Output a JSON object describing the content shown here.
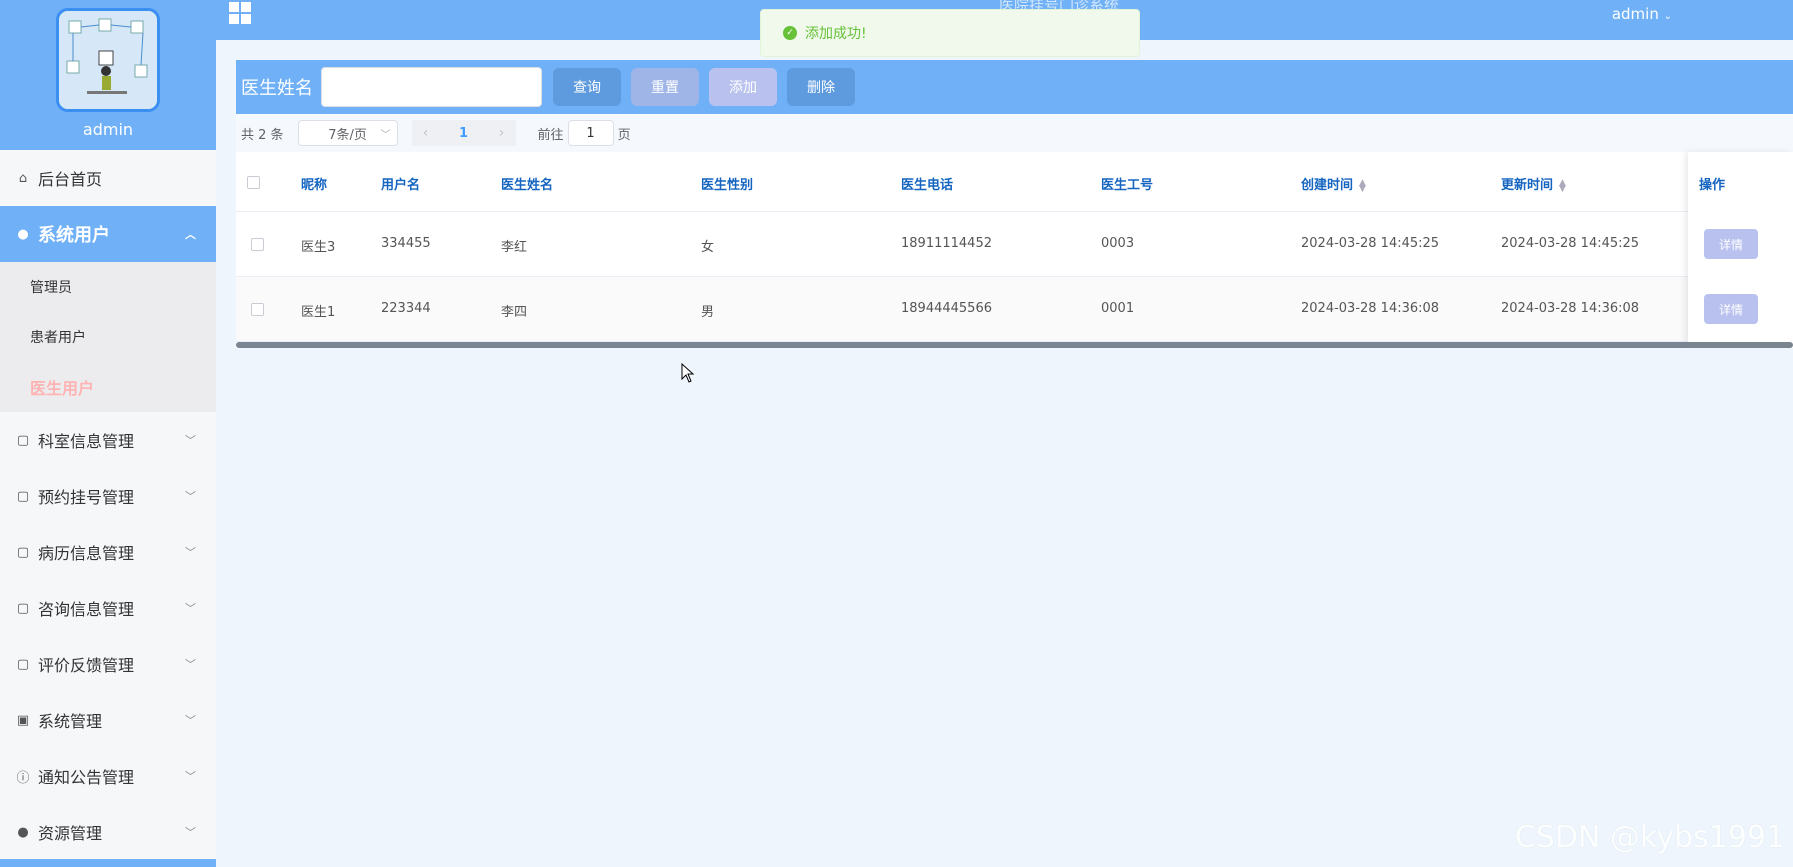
{
  "sidebar": {
    "profile_name": "admin",
    "items": [
      {
        "label": "后台首页",
        "icon": "home-icon"
      },
      {
        "label": "系统用户",
        "icon": "user-icon",
        "active": true,
        "children": [
          {
            "label": "管理员"
          },
          {
            "label": "患者用户"
          },
          {
            "label": "医生用户",
            "current": true
          }
        ]
      },
      {
        "label": "科室信息管理",
        "icon": "folder-icon"
      },
      {
        "label": "预约挂号管理",
        "icon": "folder-icon"
      },
      {
        "label": "病历信息管理",
        "icon": "folder-icon"
      },
      {
        "label": "咨询信息管理",
        "icon": "folder-icon"
      },
      {
        "label": "评价反馈管理",
        "icon": "folder-icon"
      },
      {
        "label": "系统管理",
        "icon": "picture-icon"
      },
      {
        "label": "通知公告管理",
        "icon": "info-icon"
      },
      {
        "label": "资源管理",
        "icon": "bulb-icon"
      }
    ]
  },
  "header": {
    "title": "医院挂号门诊系统",
    "user_menu": "admin"
  },
  "toast": {
    "message": "添加成功!",
    "color": "#67c23a"
  },
  "search": {
    "label": "医生姓名",
    "value": "",
    "buttons": {
      "query": "查询",
      "reset": "重置",
      "add": "添加",
      "delete": "删除"
    }
  },
  "pagination": {
    "total": "共 2 条",
    "page_size": "7条/页",
    "current_page": "1",
    "goto_prefix": "前往",
    "goto_value": "1",
    "goto_suffix": "页"
  },
  "table": {
    "columns": [
      "昵称",
      "用户名",
      "医生姓名",
      "医生性别",
      "医生电话",
      "医生工号",
      "创建时间",
      "更新时间",
      "操作"
    ],
    "rows": [
      {
        "nickname": "医生3",
        "username": "334455",
        "name": "李红",
        "gender": "女",
        "phone": "18911114452",
        "job_no": "0003",
        "created": "2024-03-28 14:45:25",
        "updated": "2024-03-28 14:45:25",
        "action": "详情"
      },
      {
        "nickname": "医生1",
        "username": "223344",
        "name": "李四",
        "gender": "男",
        "phone": "18944445566",
        "job_no": "0001",
        "created": "2024-03-28 14:36:08",
        "updated": "2024-03-28 14:36:08",
        "action": "详情"
      }
    ]
  },
  "watermark": "CSDN @kybs1991",
  "colors": {
    "primary": "#6fb0f7",
    "button_blue": "#5d9ade",
    "button_light": "#b9c2ee",
    "header_text": "#1565c0"
  }
}
